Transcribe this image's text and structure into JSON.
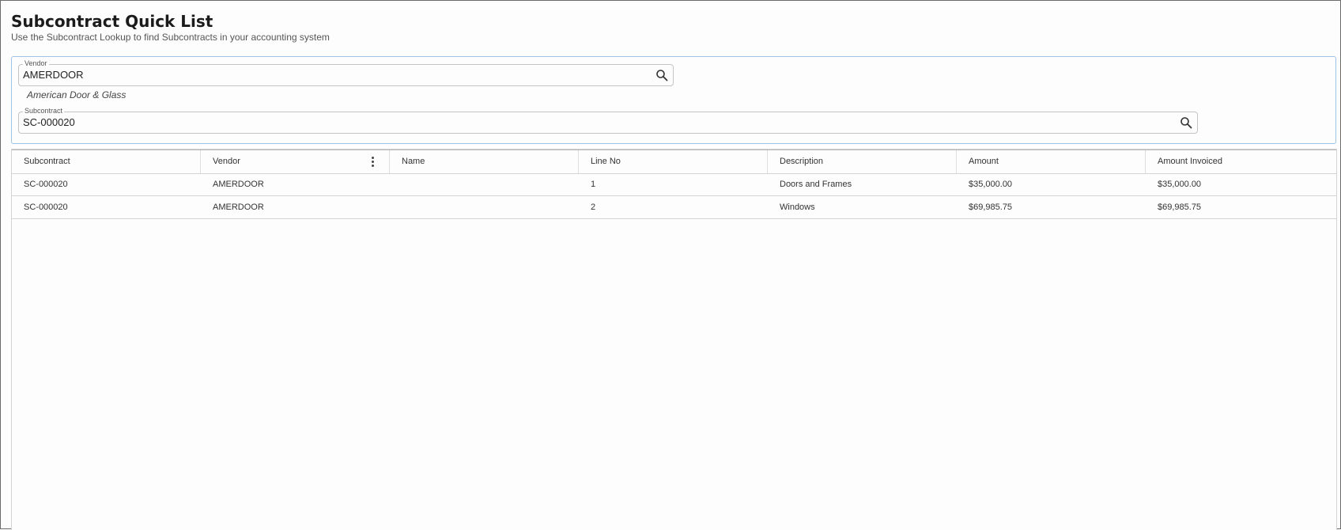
{
  "page": {
    "title": "Subcontract Quick List",
    "subtitle": "Use the Subcontract Lookup to find Subcontracts in your accounting system"
  },
  "filters": {
    "vendor": {
      "label": "Vendor",
      "value": "AMERDOOR",
      "name_display": "American Door & Glass",
      "icon": "search-icon"
    },
    "subcontract": {
      "label": "Subcontract",
      "value": "SC-000020",
      "icon": "search-icon"
    }
  },
  "grid": {
    "columns": [
      "Subcontract",
      "Vendor",
      "Name",
      "Line No",
      "Description",
      "Amount",
      "Amount Invoiced"
    ],
    "column_menu_icon": "vertical-dots-icon",
    "rows": [
      {
        "subcontract": "SC-000020",
        "vendor": "AMERDOOR",
        "name": "",
        "line_no": "1",
        "description": "Doors and Frames",
        "amount": "$35,000.00",
        "amount_invoiced": "$35,000.00"
      },
      {
        "subcontract": "SC-000020",
        "vendor": "AMERDOOR",
        "name": "",
        "line_no": "2",
        "description": "Windows",
        "amount": "$69,985.75",
        "amount_invoiced": "$69,985.75"
      }
    ]
  },
  "colors": {
    "accent_border": "#9ec5e8",
    "text": "#222222",
    "muted": "#555555"
  }
}
